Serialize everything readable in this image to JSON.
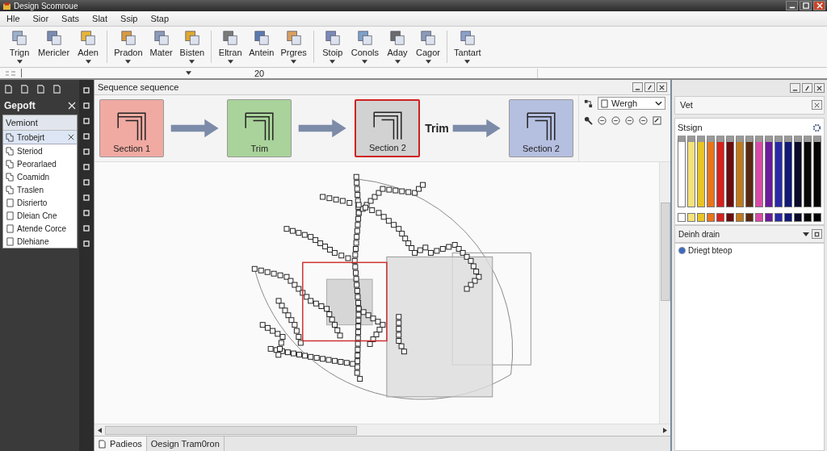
{
  "window": {
    "title": "Design Scomroue"
  },
  "menu": [
    "Hle",
    "Sior",
    "Sats",
    "Slat",
    "Ssip",
    "Stap"
  ],
  "toolbar": [
    [
      {
        "label": "Trign",
        "dropdown": true
      },
      {
        "label": "Mericler",
        "dropdown": false
      },
      {
        "label": "Aden",
        "dropdown": true
      }
    ],
    [
      {
        "label": "Pradon",
        "dropdown": true
      },
      {
        "label": "Mater",
        "dropdown": false
      },
      {
        "label": "Bisten",
        "dropdown": true
      }
    ],
    [
      {
        "label": "Eltran",
        "dropdown": true
      },
      {
        "label": "Antein",
        "dropdown": false
      },
      {
        "label": "Prgres",
        "dropdown": true
      }
    ],
    [
      {
        "label": "Stoip",
        "dropdown": true
      },
      {
        "label": "Conols",
        "dropdown": true
      },
      {
        "label": "Aday",
        "dropdown": true
      },
      {
        "label": "Cagor",
        "dropdown": true
      }
    ],
    [
      {
        "label": "Tantart",
        "dropdown": true
      }
    ]
  ],
  "formula_bar": {
    "value": "20"
  },
  "left_panel": {
    "title": "Gepoft",
    "list_header": "Vemiont",
    "items": [
      {
        "label": "Trobejrt",
        "kind": "stack",
        "selected": true
      },
      {
        "label": "Steriod",
        "kind": "stack",
        "selected": false
      },
      {
        "label": "Peorarlaed",
        "kind": "stack",
        "selected": false
      },
      {
        "label": "Coamidn",
        "kind": "stack",
        "selected": false
      },
      {
        "label": "Traslen",
        "kind": "stack",
        "selected": false
      },
      {
        "label": "Disrierto",
        "kind": "page",
        "selected": false
      },
      {
        "label": "Dleian Cne",
        "kind": "page",
        "selected": false
      },
      {
        "label": "Atende Corce",
        "kind": "page",
        "selected": false
      },
      {
        "label": "Dlehiane",
        "kind": "page",
        "selected": false
      }
    ]
  },
  "sequence_panel": {
    "title": "Sequence sequence",
    "dropdown": "Wergh",
    "steps": [
      {
        "label": "Section 1",
        "color": "#f0aaa2",
        "selected": false
      },
      {
        "label": "Trim",
        "color": "#a9d39a",
        "selected": false
      },
      {
        "label": "Section 2",
        "color": "#d2d2d2",
        "selected": true,
        "arrow_label": "Trim"
      },
      {
        "label": "Section 2",
        "color": "#b5bfe0",
        "selected": false
      }
    ]
  },
  "right_panel": {
    "title": "Vet",
    "swatch_title": "Stsign",
    "swatches": [
      {
        "color": "#ffffff"
      },
      {
        "color": "#f4e27a"
      },
      {
        "color": "#e9c424"
      },
      {
        "color": "#e8741c"
      },
      {
        "color": "#d8201c"
      },
      {
        "color": "#6e0c0c"
      },
      {
        "color": "#c07a1c"
      },
      {
        "color": "#5a2810"
      },
      {
        "color": "#d84aa8"
      },
      {
        "color": "#6a1a9a"
      },
      {
        "color": "#2a28a8"
      },
      {
        "color": "#101878"
      },
      {
        "color": "#0a0a2a"
      },
      {
        "color": "#080808"
      },
      {
        "color": "#040404"
      }
    ],
    "section_title": "Deinh drain",
    "options": [
      {
        "label": "Driegt bteop",
        "selected": true
      }
    ]
  },
  "bottom_tabs": [
    {
      "label": "Padieos",
      "selected": true
    },
    {
      "label": "Oesign Tram0ron",
      "selected": false
    }
  ]
}
